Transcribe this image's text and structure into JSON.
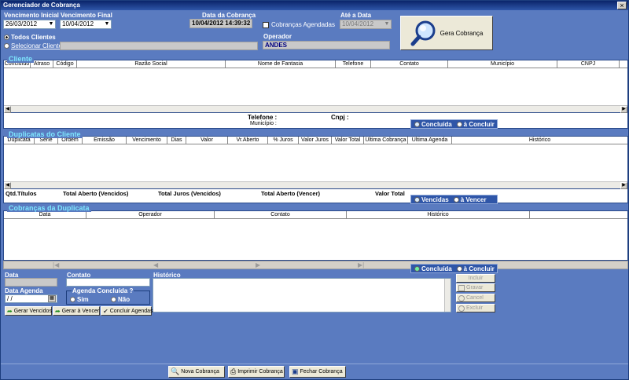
{
  "window": {
    "title": "Gerenciador de Cobrança",
    "close_glyph": "×"
  },
  "filters": {
    "vencimento_inicial_label": "Vencimento Inicial",
    "vencimento_inicial_value": "26/03/2012",
    "vencimento_final_label": "Vencimento Final",
    "vencimento_final_value": "10/04/2012",
    "data_cobranca_label": "Data da Cobrança",
    "data_cobranca_value": "10/04/2012 14:39:32",
    "cobrancas_agendadas_label": "Cobranças Agendadas",
    "ate_data_label": "Até a Data",
    "ate_data_value": "10/04/2012",
    "todos_clientes_label": "Todos Clientes",
    "selecionar_cliente_label": "Selecionar Cliente",
    "operador_label": "Operador",
    "operador_value": "ANDES",
    "gera_cobranca_label": "Gera Cobrança"
  },
  "cliente": {
    "title": "Cliente",
    "columns": [
      "Concluído",
      "Atraso",
      "Código",
      "Razão Social",
      "Nome de Fantasia",
      "Telefone",
      "Contato",
      "Município",
      "CNPJ"
    ],
    "telefone_label": "Telefone :",
    "cnpj_label": "Cnpj :",
    "municipio_label": "Município :",
    "tab_concluida": "Concluída",
    "tab_a_concluir": "à Concluir"
  },
  "duplicatas": {
    "title": "Duplicatas do Cliente",
    "columns": [
      "Duplicata",
      "Série",
      "Ordem",
      "Emissão",
      "Vencimento",
      "Dias",
      "Valor",
      "Vr.Aberto",
      "% Juros",
      "Valor Juros",
      "Valor Total",
      "Última Cobrança",
      "Última Agenda",
      "Histórico"
    ],
    "qtd_titulos": "Qtd.Títulos",
    "total_aberto_vencidos": "Total Aberto (Vencidos)",
    "total_juros_vencidos": "Total Juros (Vencidos)",
    "total_aberto_vencer": "Total Aberto (Vencer)",
    "valor_total": "Valor Total",
    "tab_vencidas": "Vencidas",
    "tab_a_vencer": "à Vencer"
  },
  "cobrancas": {
    "title": "Cobranças da Duplicata",
    "columns": [
      "Data",
      "Operador",
      "Contato",
      "Histórico"
    ],
    "tab_concluida": "Concluída",
    "tab_a_concluir": "à Concluir"
  },
  "form": {
    "data_label": "Data",
    "contato_label": "Contato",
    "historico_label": "Histórico",
    "data_agenda_label": "Data Agenda",
    "data_agenda_value": " / /",
    "agenda_concluida_label": "Agenda Concluída ?",
    "sim_label": "Sim",
    "nao_label": "Não",
    "incluir_label": "Incluir",
    "gravar_label": "Gravar",
    "cancel_label": "Cancel",
    "excluir_label": "Excluir",
    "gerar_vencidos_label": "Gerar Vencidos",
    "gerar_a_vencer_label": "Gerar à Vencer",
    "concluir_agendas_label": "Concluir Agendas"
  },
  "footer": {
    "nova_cobranca_label": "Nova Cobrança",
    "imprimir_cobranca_label": "Imprimir Cobrança",
    "fechar_cobranca_label": "Fechar Cobrança"
  },
  "colors": {
    "window_bg": "#5a7bc0",
    "title_bar": "#0a246a",
    "section_title": "#7ee8ff"
  }
}
